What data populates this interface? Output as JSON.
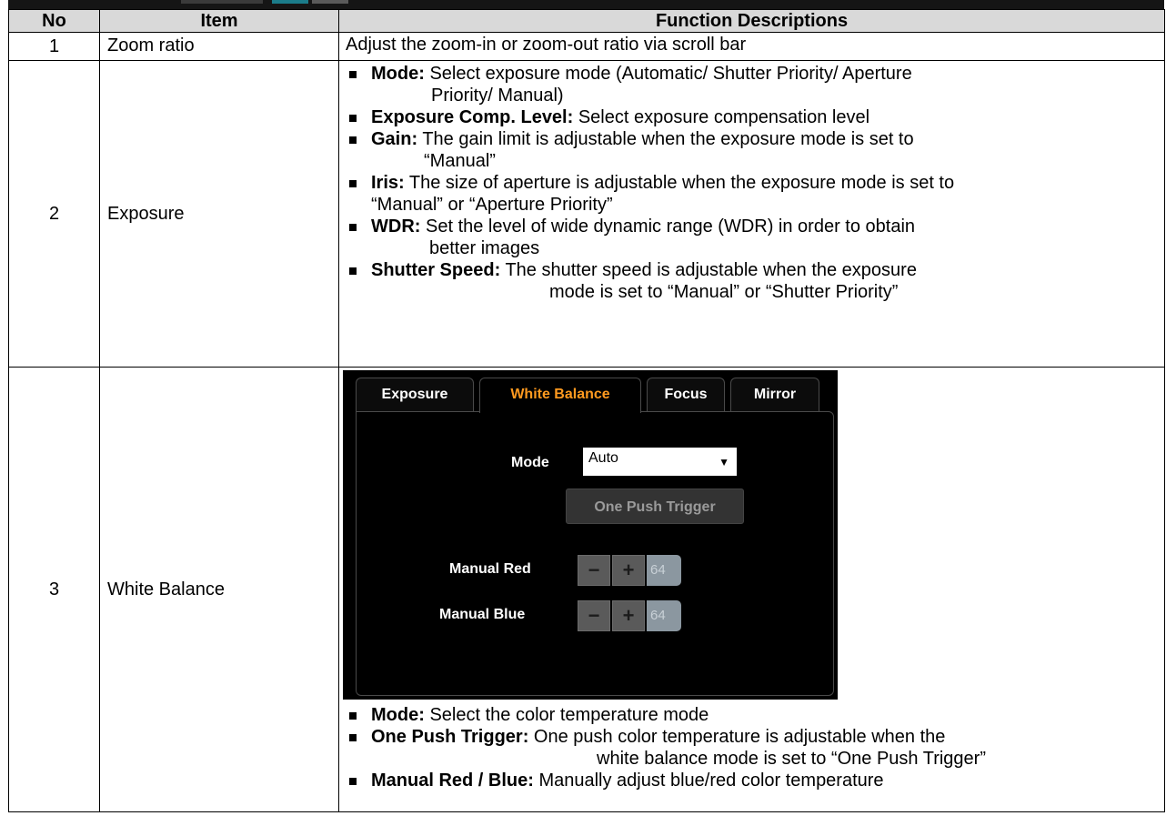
{
  "table": {
    "headers": {
      "no": "No",
      "item": "Item",
      "desc": "Function Descriptions"
    },
    "rows": [
      {
        "no": "1",
        "item": "Zoom ratio",
        "desc": "Adjust the zoom-in or zoom-out ratio via scroll bar"
      },
      {
        "no": "2",
        "item": "Exposure",
        "bullets": [
          {
            "term": "Mode:",
            "text": " Select exposure mode (Automatic/ Shutter Priority/ Aperture",
            "cont": "Priority/ Manual)"
          },
          {
            "term": "Exposure Comp. Level:",
            "text": " Select exposure compensation level"
          },
          {
            "term": "Gain:",
            "text": " The gain limit is adjustable when the exposure mode is set to",
            "cont": "“Manual”"
          },
          {
            "term": "Iris:",
            "text": " The size of aperture is adjustable when the exposure mode is set to",
            "cont": "“Manual” or “Aperture Priority”"
          },
          {
            "term": "WDR:",
            "text": " Set the level of wide dynamic range (WDR) in order to obtain",
            "cont": "better images"
          },
          {
            "term": "Shutter Speed:",
            "text": " The shutter speed is adjustable when the exposure",
            "cont": "mode is set to “Manual” or “Shutter Priority”"
          }
        ]
      },
      {
        "no": "3",
        "item": "White Balance",
        "bullets": [
          {
            "term": "Mode:",
            "text": " Select the color temperature mode"
          },
          {
            "term": "One Push Trigger:",
            "text": " One push color temperature is adjustable when the",
            "cont": "white balance mode is set to “One Push Trigger”"
          },
          {
            "term": "Manual Red / Blue:",
            "text": " Manually adjust blue/red color temperature"
          }
        ]
      }
    ]
  },
  "camera_ui": {
    "tabs": [
      "Exposure",
      "White Balance",
      "Focus",
      "Mirror"
    ],
    "active_tab": "White Balance",
    "mode_label": "Mode",
    "mode_value": "Auto",
    "one_push_button": "One Push Trigger",
    "manual_red_label": "Manual Red",
    "manual_red_value": "64",
    "manual_blue_label": "Manual Blue",
    "manual_blue_value": "64",
    "minus_symbol": "−",
    "plus_symbol": "+",
    "dropdown_arrow": "▼",
    "accent_color": "#ff9a1f"
  }
}
